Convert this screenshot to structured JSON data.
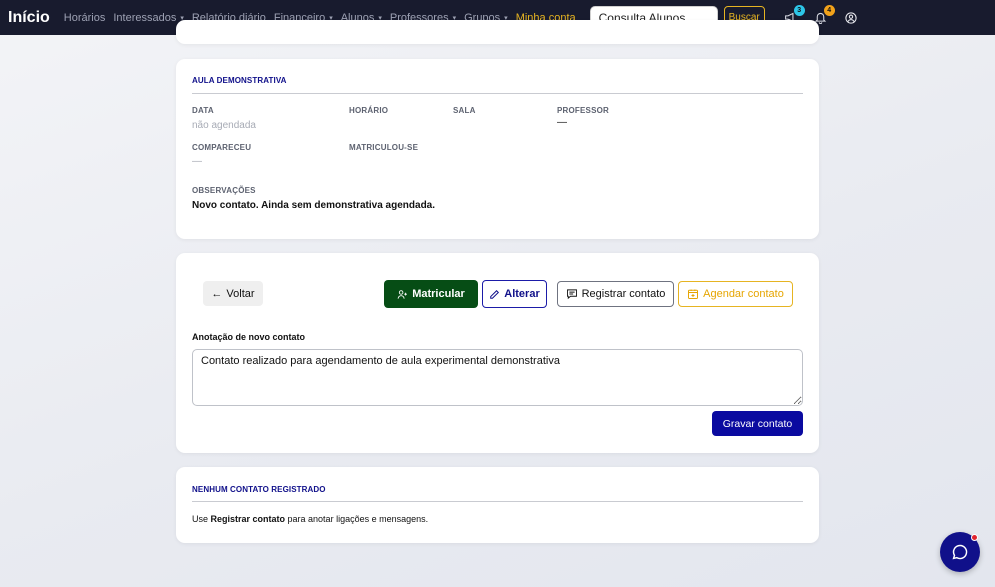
{
  "navbar": {
    "brand": "Início",
    "items": [
      {
        "label": "Horários",
        "dropdown": false
      },
      {
        "label": "Interessados",
        "dropdown": true
      },
      {
        "label": "Relatório diário",
        "dropdown": false
      },
      {
        "label": "Financeiro",
        "dropdown": true
      },
      {
        "label": "Alunos",
        "dropdown": true
      },
      {
        "label": "Professores",
        "dropdown": true
      },
      {
        "label": "Grupos",
        "dropdown": true
      }
    ],
    "highlight_item": "Minha conta",
    "search_value": "Consulta Alunos",
    "search_button": "Buscar",
    "announcements_count": "3",
    "notifications_count": "4",
    "icons": [
      "megaphone-icon",
      "bell-icon",
      "user-circle-icon"
    ]
  },
  "aula": {
    "title": "AULA DEMONSTRATIVA",
    "data_label": "DATA",
    "data_value": "não agendada",
    "horario_label": "HORÁRIO",
    "sala_label": "SALA",
    "professor_label": "PROFESSOR",
    "professor_value": "—",
    "compareceu_label": "COMPARECEU",
    "compareceu_value": "—",
    "matriculou_label": "MATRICULOU-SE",
    "observacoes_label": "OBSERVAÇÕES",
    "observacoes_value": "Novo contato. Ainda sem demonstrativa agendada."
  },
  "actions": {
    "voltar": "Voltar",
    "matricular": "Matricular",
    "alterar": "Alterar",
    "registrar": "Registrar contato",
    "agendar": "Agendar contato",
    "anotacao_label": "Anotação de novo contato",
    "anotacao_value": "Contato realizado para agendamento de aula experimental demonstrativa",
    "gravar": "Gravar contato"
  },
  "contatos": {
    "title": "NENHUM CONTATO REGISTRADO",
    "help_prefix": "Use ",
    "help_bold": "Registrar contato",
    "help_suffix": " para anotar ligações e mensagens."
  },
  "colors": {
    "navbar_bg": "#181b2e",
    "accent_navy": "#10108a",
    "accent_gold": "#e6b422",
    "matricular_green": "#064d15",
    "badge_cyan": "#2dc6e8",
    "badge_orange": "#f2a21a"
  }
}
